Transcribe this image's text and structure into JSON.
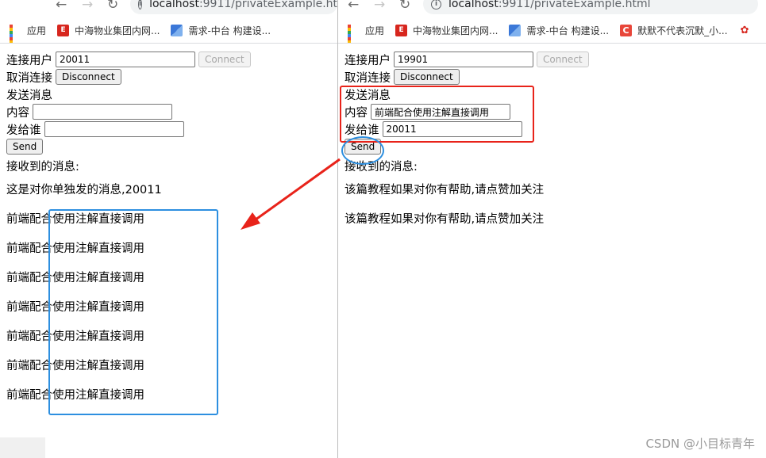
{
  "left": {
    "url_host": "localhost",
    "url_path": ":9911/privateExample.htm",
    "connect_user_label": "连接用户",
    "user_value": "20011",
    "connect_button": "Connect",
    "disconnect_label": "取消连接",
    "disconnect_button": "Disconnect",
    "send_section_label": "发送消息",
    "content_label": "内容",
    "content_value": "",
    "to_label": "发给谁",
    "to_value": "",
    "send_button": "Send",
    "received_label": "接收到的消息:",
    "messages": [
      "这是对你单独发的消息,20011",
      "前端配合使用注解直接调用",
      "前端配合使用注解直接调用",
      "前端配合使用注解直接调用",
      "前端配合使用注解直接调用",
      "前端配合使用注解直接调用",
      "前端配合使用注解直接调用",
      "前端配合使用注解直接调用"
    ]
  },
  "right": {
    "url_host": "localhost",
    "url_path": ":9911/privateExample.html",
    "connect_user_label": "连接用户",
    "user_value": "19901",
    "connect_button": "Connect",
    "disconnect_label": "取消连接",
    "disconnect_button": "Disconnect",
    "send_section_label": "发送消息",
    "content_label": "内容",
    "content_value": "前端配合使用注解直接调用",
    "to_label": "发给谁",
    "to_value": "20011",
    "send_button": "Send",
    "received_label": "接收到的消息:",
    "messages": [
      "该篇教程如果对你有帮助,请点赞加关注",
      "该篇教程如果对你有帮助,请点赞加关注"
    ]
  },
  "bookmarks": {
    "apps": "应用",
    "item1": "中海物业集团内网...",
    "item2": "需求-中台 构建设...",
    "item3": "默默不代表沉默_小...",
    "item1_icon": "red-e-icon",
    "item2_icon": "blue-flag-icon",
    "item3_icon": "csdn-c-icon",
    "item4_icon": "huawei-icon"
  },
  "annotations": {
    "red_box_color": "#e8231a",
    "blue_color": "#2d8fe0",
    "arrow_color": "#e8231a"
  },
  "watermark": "CSDN @小目标青年"
}
